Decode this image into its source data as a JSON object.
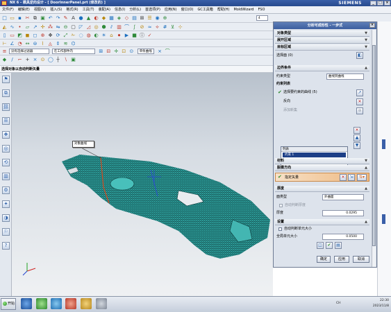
{
  "window": {
    "title": "NX 6 - 模具逆向设计 - [ DoorInnerPanel.prt (修改的) ]",
    "brand": "SIEMENS"
  },
  "menu": [
    "文件(F)",
    "编辑(E)",
    "视图(V)",
    "插入(S)",
    "格式(R)",
    "工具(T)",
    "装配(A)",
    "信息(I)",
    "分析(L)",
    "首选项(P)",
    "应用(N)",
    "窗口(O)",
    "GC工具箱",
    "帮助(H)",
    "MoldWizard",
    "FSO"
  ],
  "toolbar": {
    "filter_combo": "没有选择过滤器",
    "assembly_combo": "在工作部件内",
    "select_combo": "单条曲线",
    "row1_combo": "4"
  },
  "status_prompt": "选择对象以自动判断矢量",
  "tooltip": "对象曲线",
  "dialog": {
    "title": "分析可成形性 - 一步式",
    "sections": [
      "对象类型",
      "展开区域",
      "目标区域",
      "材料",
      "脱模方向",
      "厚度",
      "设置"
    ],
    "object_label": "选择面 (0)",
    "boundary_section": "边界条件",
    "constraint_type_label": "约束类型",
    "constraint_type_value": "曲线到曲线",
    "constraint_list_label": "约束列表",
    "select_curve": "选择要约束的曲线 (5)",
    "direction_label": "反向",
    "extra_label": "添加新集",
    "list_header": "列表",
    "list_item": "约束 1",
    "material_section": "材料",
    "direction_section": "脱模方向",
    "vector_label": "指定矢量",
    "thickness_section": "厚度",
    "face_type_label": "面类型",
    "face_type_value": "外曲面",
    "thickness_check": "自动判断厚度",
    "thickness_label": "厚度",
    "thickness_value": "0.0295",
    "settings_section": "设置",
    "auto_check": "自动判断单元大小",
    "global_label": "全局单元大小",
    "global_value": "0.0500",
    "ok": "确定",
    "apply": "应用",
    "cancel": "取消"
  },
  "taskbar": {
    "start": "开始",
    "time": "22:30",
    "date": "2023/11/8",
    "lang": "CH"
  }
}
